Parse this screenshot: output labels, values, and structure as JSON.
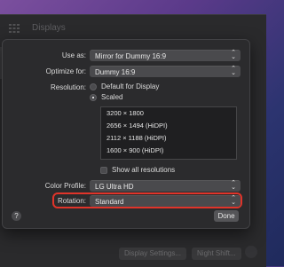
{
  "window": {
    "title": "Displays"
  },
  "sheet": {
    "use_as": {
      "label": "Use as:",
      "value": "Mirror for Dummy 16:9"
    },
    "optimize_for": {
      "label": "Optimize for:",
      "value": "Dummy 16:9"
    },
    "resolution": {
      "label": "Resolution:",
      "options": [
        "Default for Display",
        "Scaled"
      ],
      "selected": "Scaled",
      "list": [
        "3200 × 1800",
        "2656 × 1494 (HiDPI)",
        "2112 × 1188 (HiDPI)",
        "1600 × 900 (HiDPI)"
      ]
    },
    "show_all_resolutions": {
      "label": "Show all resolutions",
      "checked": false
    },
    "color_profile": {
      "label": "Color Profile:",
      "value": "LG Ultra HD"
    },
    "rotation": {
      "label": "Rotation:",
      "value": "Standard"
    },
    "help_label": "?",
    "done_label": "Done"
  },
  "background_buttons": {
    "display_settings": "Display Settings...",
    "night_shift": "Night Shift..."
  },
  "colors": {
    "highlight": "#e0342a",
    "sheet_bg": "#2b2b2d"
  }
}
